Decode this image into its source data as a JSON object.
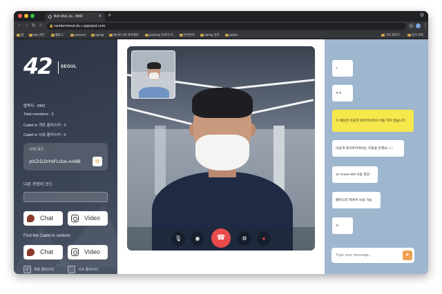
{
  "browser": {
    "tab_title": "Bob Muk Za - BMZ",
    "new_tab": "+",
    "url": "randommeal.du.r.appspot.com",
    "bookmarks": [
      {
        "label": "앱"
      },
      {
        "label": "IDE 관련"
      },
      {
        "label": "웹표그"
      },
      {
        "label": "42Seoul"
      },
      {
        "label": "Spring"
      },
      {
        "label": "레시피 4파 아카에버"
      },
      {
        "label": "[Udemy] 유데미 자..."
      },
      {
        "label": "변경관리"
      },
      {
        "label": "Spring 관련"
      },
      {
        "label": "webrtc"
      }
    ],
    "bookmarks_right": [
      {
        "label": "기타 북마크"
      },
      {
        "label": "읽기 목록"
      }
    ]
  },
  "sidebar": {
    "brand": "42",
    "brand_sub": "SEOUL",
    "stats": [
      {
        "text": "밥묵자 - BMZ"
      },
      {
        "text": "Total members : 2"
      },
      {
        "text": "Cadet in 개포 클러스터 : 2"
      },
      {
        "text": "Cadet in 서초 클러스터 : 0"
      }
    ],
    "my_code_label": "나의 코드",
    "my_code_value": "ytXZrDZbYbFLGoc-AABB",
    "other_code_label": "다른 카뎃의 코드",
    "other_code_value": "",
    "chat_label": "Chat",
    "video_label": "Video",
    "find_label": "Find the Cadet in random",
    "find_chat_label": "Chat",
    "find_video_label": "Video",
    "check_gaepo": "개포 클러스터",
    "check_gaepo_checked": "✓",
    "check_seocho": "서초 클러스터"
  },
  "call": {
    "mic_icon": "mic-off-icon",
    "camera_icon": "camera-icon",
    "hangup_icon": "phone-hangup-icon",
    "settings_icon": "settings-icon",
    "record_icon": "record-icon"
  },
  "chat": {
    "messages": [
      {
        "text": "?"
      },
      {
        "text": "ㅎㅎ"
      },
      {
        "text": "이 채팅은 비공개 와이파이에서 작동 하지 않습니다.",
        "highlight": true
      },
      {
        "text": "비공개 와이파이에서는 작동을 안해요~~~"
      },
      {
        "text": "42 Guest Wifi 사용 권장"
      },
      {
        "text": "클러스터 맥에서 사용 가능"
      },
      {
        "text": "ㅎ"
      }
    ],
    "input_placeholder": "Type your message...",
    "send_icon": "send-icon"
  },
  "colors": {
    "sidebar": "#333b4b",
    "chat_bg": "#9fb6cf",
    "highlight_msg": "#f5e84a",
    "hangup": "#e94b4b",
    "send": "#f0a050"
  }
}
